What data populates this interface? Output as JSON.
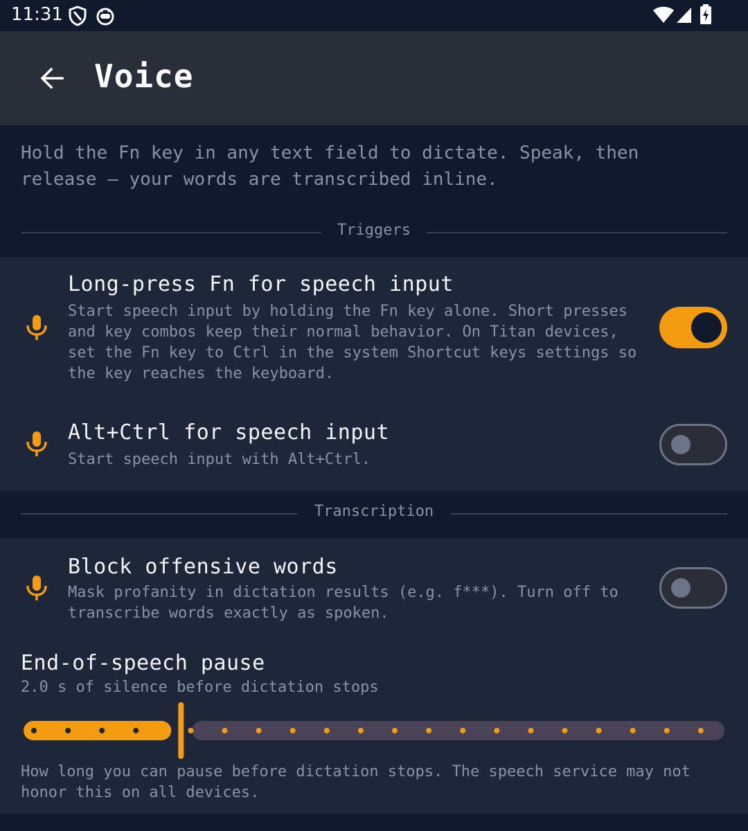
{
  "status_bar": {
    "time": "11:31",
    "left_icons": [
      "shield-icon",
      "robot-icon"
    ],
    "right_icons": [
      "wifi-icon",
      "signal-icon",
      "battery-charging-icon"
    ]
  },
  "app_bar": {
    "back_icon": "arrow-back-icon",
    "title": "Voice"
  },
  "intro": "Hold the Fn key in any text field to dictate. Speak, then release — your words are transcribed inline.",
  "sections": {
    "triggers": {
      "label": "Triggers",
      "items": [
        {
          "icon": "microphone-icon",
          "title": "Long-press Fn for speech input",
          "description": "Start speech input by holding the Fn key alone. Short presses and key combos keep their normal behavior. On Titan devices, set the Fn key to Ctrl in the system Shortcut keys settings so the key reaches the keyboard.",
          "enabled": true
        },
        {
          "icon": "microphone-icon",
          "title": "Alt+Ctrl for speech input",
          "description": "Start speech input with Alt+Ctrl.",
          "enabled": false
        }
      ]
    },
    "transcription": {
      "label": "Transcription",
      "items": [
        {
          "icon": "microphone-icon",
          "title": "Block offensive words",
          "description": "Mask profanity in dictation results (e.g. f***). Turn off to transcribe words exactly as spoken.",
          "enabled": false
        }
      ],
      "pause_slider": {
        "title": "End-of-speech pause",
        "value_text": "2.0 s of silence before dictation stops",
        "value": 2.0,
        "steps": 21,
        "selected_step": 4,
        "footer": "How long you can pause before dictation stops. The speech service may not honor this on all devices."
      }
    }
  },
  "colors": {
    "background": "#111a2d",
    "app_bar": "#292f39",
    "card": "#1e273a",
    "accent": "#f39c12",
    "text_primary": "#f3f5f9",
    "text_secondary": "#8a93a3",
    "slider_track_inactive": "#4a4257"
  }
}
